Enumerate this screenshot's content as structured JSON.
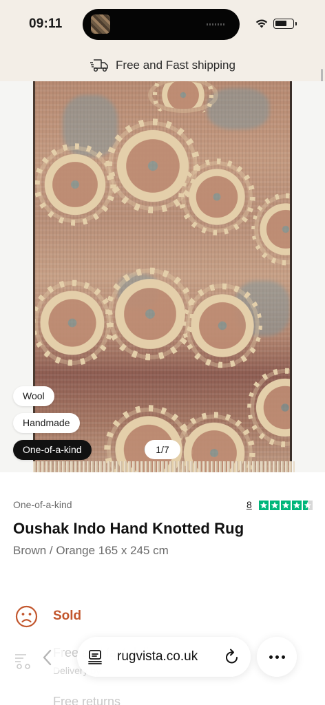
{
  "status_bar": {
    "time": "09:11",
    "icons": [
      "wifi-icon",
      "battery-icon"
    ]
  },
  "banner": {
    "shipping_text": "Free and Fast shipping",
    "icon": "truck-icon"
  },
  "gallery": {
    "tags": [
      "Wool",
      "Handmade",
      "One-of-a-kind"
    ],
    "counter": "1/7"
  },
  "product": {
    "category": "One-of-a-kind",
    "review_count": "8",
    "rating_stars": 4.5,
    "title": "Oushak Indo Hand Knotted Rug",
    "subtitle": "Brown / Orange 165 x 245 cm"
  },
  "availability": {
    "status": "Sold",
    "status_color": "#c2562d",
    "icon": "sad-face-icon"
  },
  "faded_rows": {
    "delivery_title": "Free and fast delivery",
    "delivery_sub": "Delivery by",
    "returns_title": "Free returns"
  },
  "browser": {
    "url": "rugvista.co.uk"
  },
  "colors": {
    "header_bg": "#f3eee7",
    "trustpilot_green": "#00b67a"
  }
}
